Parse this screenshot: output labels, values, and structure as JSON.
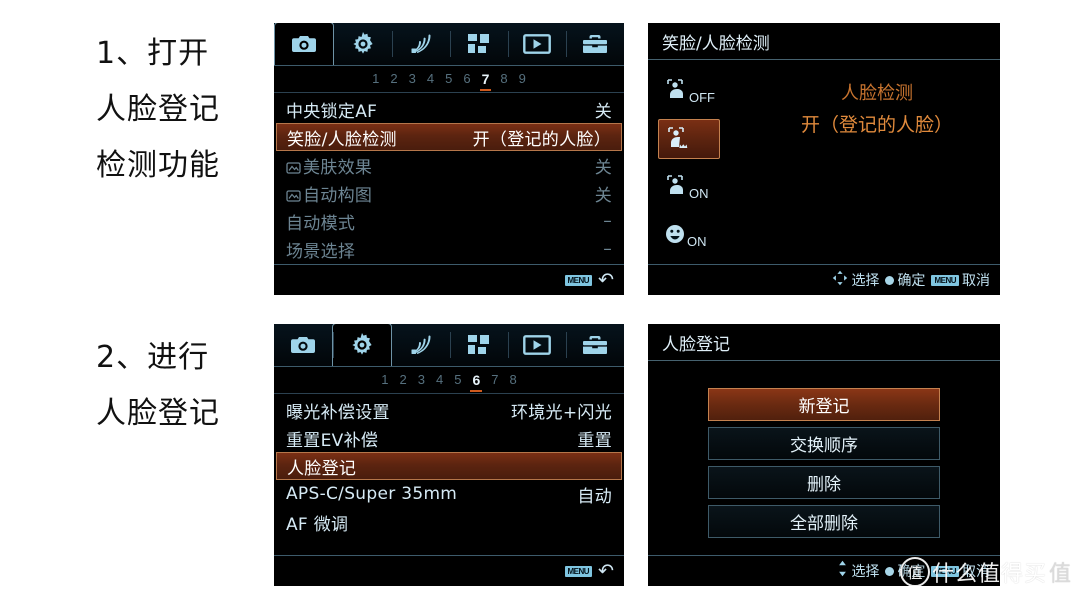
{
  "instructions": [
    {
      "id": "step-1",
      "lines": [
        "1、打开",
        "人脸登记",
        "检测功能"
      ]
    },
    {
      "id": "step-2",
      "lines": [
        "2、进行",
        "人脸登记"
      ]
    }
  ],
  "screens": {
    "top_left": {
      "name": "camera-shooting-menu",
      "tabs": [
        {
          "icon": "camera-icon",
          "active": true
        },
        {
          "icon": "gear-icon",
          "active": false
        },
        {
          "icon": "wifi-icon",
          "active": false
        },
        {
          "icon": "grid-apps-icon",
          "active": false
        },
        {
          "icon": "playback-icon",
          "active": false
        },
        {
          "icon": "toolbox-icon",
          "active": false
        }
      ],
      "pages": [
        "1",
        "2",
        "3",
        "4",
        "5",
        "6",
        "7",
        "8",
        "9"
      ],
      "active_page": "7",
      "rows": [
        {
          "label": "中央锁定AF",
          "value": "关",
          "state": "normal",
          "lead_icon": ""
        },
        {
          "label": "笑脸/人脸检测",
          "value": "开（登记的人脸）",
          "state": "selected",
          "lead_icon": ""
        },
        {
          "label": "美肤效果",
          "value": "关",
          "state": "dim",
          "lead_icon": "movie-icon"
        },
        {
          "label": "自动构图",
          "value": "关",
          "state": "dim",
          "lead_icon": "movie-icon"
        },
        {
          "label": "自动模式",
          "value": "–",
          "state": "dim",
          "lead_icon": ""
        },
        {
          "label": "场景选择",
          "value": "–",
          "state": "dim",
          "lead_icon": ""
        }
      ],
      "bottom": {
        "menu_chip": "MENU",
        "return_icon": "return-arrow-icon"
      }
    },
    "top_right": {
      "name": "face-detection-options",
      "title": "笑脸/人脸检测",
      "options": [
        {
          "icon": "face-detect-off-icon",
          "suffix": "OFF",
          "selected": false
        },
        {
          "icon": "face-detect-registered-icon",
          "suffix": "",
          "selected": true
        },
        {
          "icon": "face-detect-on-icon",
          "suffix": "ON",
          "selected": false
        },
        {
          "icon": "smile-shutter-on-icon",
          "suffix": "ON",
          "selected": false
        }
      ],
      "detail_title": "人脸检测",
      "detail_value": "开（登记的人脸）",
      "bottom": {
        "select_icon": "dpad-icon",
        "select_label": "选择",
        "confirm_icon": "center-button-icon",
        "confirm_label": "确定",
        "cancel_chip": "MENU",
        "cancel_label": "取消"
      }
    },
    "bottom_left": {
      "name": "camera-custom-menu",
      "tabs": [
        {
          "icon": "camera-icon",
          "active": false
        },
        {
          "icon": "gear-icon",
          "active": true
        },
        {
          "icon": "wifi-icon",
          "active": false
        },
        {
          "icon": "grid-apps-icon",
          "active": false
        },
        {
          "icon": "playback-icon",
          "active": false
        },
        {
          "icon": "toolbox-icon",
          "active": false
        }
      ],
      "pages": [
        "1",
        "2",
        "3",
        "4",
        "5",
        "6",
        "7",
        "8"
      ],
      "active_page": "6",
      "rows": [
        {
          "label": "曝光补偿设置",
          "value": "环境光+闪光",
          "state": "normal"
        },
        {
          "label": "重置EV补偿",
          "value": "重置",
          "state": "normal"
        },
        {
          "label": "人脸登记",
          "value": "",
          "state": "selected"
        },
        {
          "label": "APS-C/Super 35mm",
          "value": "自动",
          "state": "normal"
        },
        {
          "label": "AF 微调",
          "value": "",
          "state": "normal"
        }
      ],
      "bottom": {
        "menu_chip": "MENU",
        "return_icon": "return-arrow-icon"
      }
    },
    "bottom_right": {
      "name": "face-registration-menu",
      "title": "人脸登记",
      "buttons": [
        {
          "label": "新登记",
          "selected": true
        },
        {
          "label": "交换顺序",
          "selected": false
        },
        {
          "label": "删除",
          "selected": false
        },
        {
          "label": "全部删除",
          "selected": false
        }
      ],
      "bottom": {
        "select_icon": "updown-arrow-icon",
        "select_label": "选择",
        "confirm_icon": "center-button-icon",
        "confirm_label": "确定",
        "cancel_chip": "MENU",
        "cancel_label": "取消"
      }
    }
  },
  "watermark": {
    "mark": "值",
    "text": "什么值得买",
    "trailing": "值"
  },
  "colors": {
    "accent_orange": "#cf5a1e",
    "highlight_brown": "#6a2a11",
    "text_blue": "#cfe6f2",
    "dim_blue": "#6d8593",
    "detail_orange": "#e08a3c"
  }
}
